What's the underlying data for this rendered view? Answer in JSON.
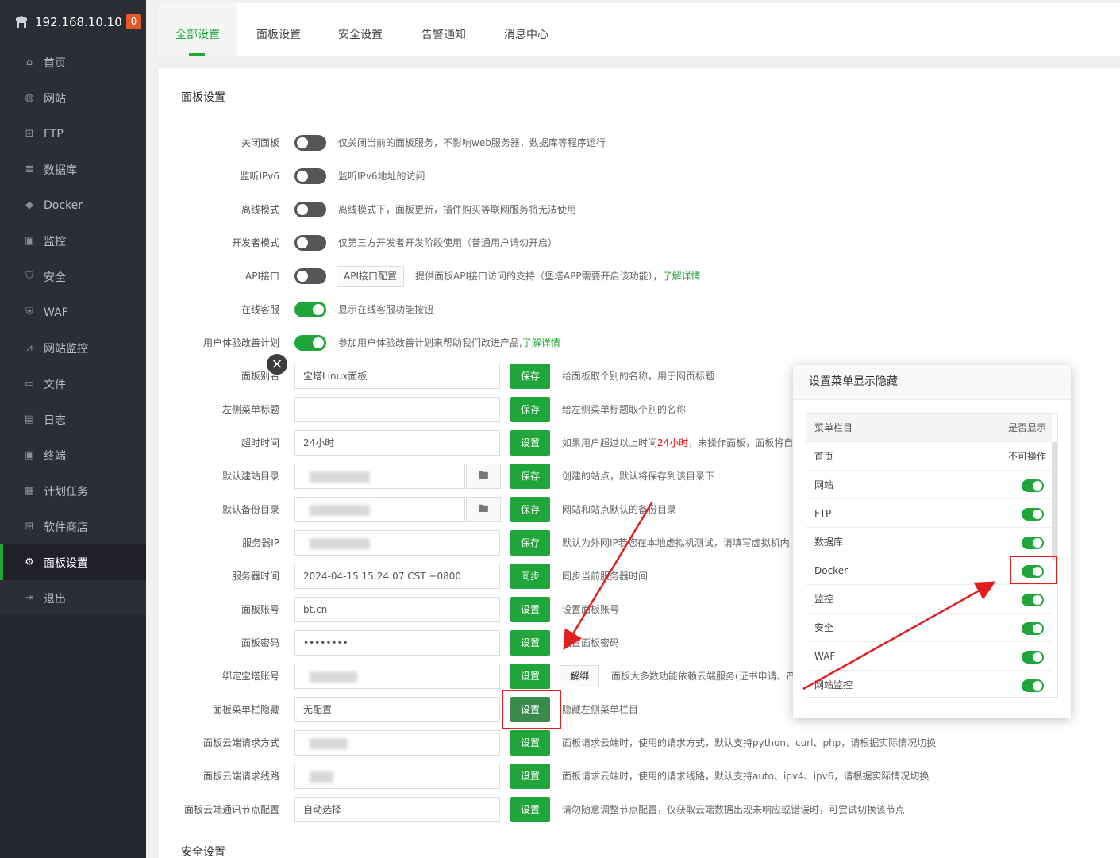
{
  "sidebar": {
    "host": "192.168.10.10",
    "badge": "0",
    "items": [
      {
        "label": "首页",
        "icon": "home-icon"
      },
      {
        "label": "网站",
        "icon": "globe-icon"
      },
      {
        "label": "FTP",
        "icon": "ftp-icon"
      },
      {
        "label": "数据库",
        "icon": "database-icon"
      },
      {
        "label": "Docker",
        "icon": "docker-icon"
      },
      {
        "label": "监控",
        "icon": "monitor-icon"
      },
      {
        "label": "安全",
        "icon": "shield-icon"
      },
      {
        "label": "WAF",
        "icon": "waf-icon"
      },
      {
        "label": "网站监控",
        "icon": "chart-icon"
      },
      {
        "label": "文件",
        "icon": "folder-icon"
      },
      {
        "label": "日志",
        "icon": "log-icon"
      },
      {
        "label": "终端",
        "icon": "terminal-icon"
      },
      {
        "label": "计划任务",
        "icon": "calendar-icon"
      },
      {
        "label": "软件商店",
        "icon": "grid-icon"
      },
      {
        "label": "面板设置",
        "icon": "gear-icon",
        "active": true
      },
      {
        "label": "退出",
        "icon": "logout-icon"
      }
    ]
  },
  "tabs": [
    "全部设置",
    "面板设置",
    "安全设置",
    "告警通知",
    "消息中心"
  ],
  "panel": {
    "title": "面板设置",
    "section2_title": "安全设置",
    "toggles": [
      {
        "label": "关闭面板",
        "desc": "仅关闭当前的面板服务，不影响web服务器，数据库等程序运行",
        "on": false
      },
      {
        "label": "监听IPv6",
        "desc": "监听IPv6地址的访问",
        "on": false
      },
      {
        "label": "离线模式",
        "desc": "离线模式下，面板更新，插件购买等联网服务将无法使用",
        "on": false
      },
      {
        "label": "开发者模式",
        "desc": "仅第三方开发者开发阶段使用（普通用户请勿开启）",
        "on": false
      },
      {
        "label": "API接口",
        "desc": "提供面板API接口访问的支持（堡塔APP需要开启该功能），",
        "link": "了解详情",
        "button": "API接口配置",
        "on": false
      },
      {
        "label": "在线客服",
        "desc": "显示在线客服功能按钮",
        "on": true
      },
      {
        "label": "用户体验改善计划",
        "desc": "参加用户体验改善计划来帮助我们改进产品,",
        "link": "了解详情",
        "on": true
      }
    ],
    "fields": [
      {
        "label": "面板别名",
        "value": "宝塔Linux面板",
        "button": "保存",
        "desc": "给面板取个别的名称，用于网页标题"
      },
      {
        "label": "左侧菜单标题",
        "value": "",
        "button": "保存",
        "desc": "给左侧菜单标题取个别的名称"
      },
      {
        "label": "超时时间",
        "value": "24小时",
        "button": "设置",
        "desc_a": "如果用户超过以上时间",
        "desc_red": "24小时",
        "desc_b": "，未操作面板，面板将自"
      },
      {
        "label": "默认建站目录",
        "value": "",
        "button": "保存",
        "desc": "创建的站点，默认将保存到该目录下"
      },
      {
        "label": "默认备份目录",
        "value": "",
        "button": "保存",
        "desc": "网站和站点默认的备份目录"
      },
      {
        "label": "服务器IP",
        "value": "",
        "button": "保存",
        "desc": "默认为外网IP若您在本地虚拟机测试，请填写虚拟机内"
      },
      {
        "label": "服务器时间",
        "value": "2024-04-15 15:24:07 CST +0800",
        "button": "同步",
        "desc": "同步当前服务器时间"
      },
      {
        "label": "面板账号",
        "value": "bt.cn",
        "button": "设置",
        "desc": "设置面板账号"
      },
      {
        "label": "面板密码",
        "value": "••••••••",
        "button": "设置",
        "desc": "设置面板密码"
      },
      {
        "label": "绑定宝塔账号",
        "value": "",
        "button": "设置",
        "button2": "解绑",
        "desc": "面板大多数功能依赖云端服务(证书申请、产"
      },
      {
        "label": "面板菜单栏隐藏",
        "value": "无配置",
        "button": "设置",
        "desc": "隐藏左侧菜单栏目"
      },
      {
        "label": "面板云端请求方式",
        "value": "",
        "button": "设置",
        "desc": "面板请求云端时，使用的请求方式，默认支持python、curl、php，请根据实际情况切换"
      },
      {
        "label": "面板云端请求线路",
        "value": "",
        "button": "设置",
        "desc": "面板请求云端时，使用的请求线路，默认支持auto、ipv4、ipv6，请根据实际情况切换"
      },
      {
        "label": "面板云端通讯节点配置",
        "value": "自动选择",
        "button": "设置",
        "desc": "请勿随意调整节点配置，仅获取云端数据出现未响应或错误时，可尝试切换该节点"
      }
    ]
  },
  "modal": {
    "title": "设置菜单显示隐藏",
    "col1": "菜单栏目",
    "col2": "是否显示",
    "rows": [
      {
        "name": "首页",
        "status": "不可操作"
      },
      {
        "name": "网站",
        "on": true
      },
      {
        "name": "FTP",
        "on": true
      },
      {
        "name": "数据库",
        "on": true
      },
      {
        "name": "Docker",
        "on": true
      },
      {
        "name": "监控",
        "on": true
      },
      {
        "name": "安全",
        "on": true
      },
      {
        "name": "WAF",
        "on": true
      },
      {
        "name": "网站监控",
        "on": true
      }
    ],
    "close_icon": "×"
  },
  "colors": {
    "accent": "#20a53a",
    "sidebar": "#2b2e35",
    "annotation": "#e02020"
  }
}
